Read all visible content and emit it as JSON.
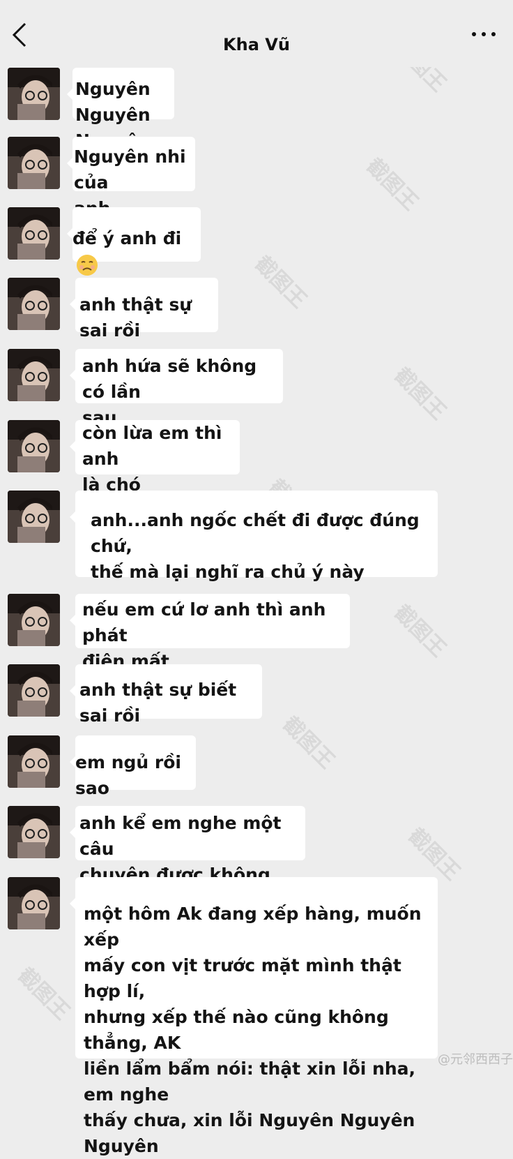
{
  "header": {
    "title": "Kha Vũ",
    "back_icon": "chevron-left-icon",
    "more_icon": "more-dots-icon"
  },
  "messages": [
    {
      "text": "Nguyên Nguyên\nNguyên"
    },
    {
      "text": "Nguyên nhi của\nanh"
    },
    {
      "text": "để ý anh đi",
      "emoji": "pouting-face-emoji"
    },
    {
      "text": "anh thật sự sai rồi"
    },
    {
      "text": "anh hứa sẽ không có lần\nsau"
    },
    {
      "text": "còn lừa em thì anh\nlà chó"
    },
    {
      "text": "anh...anh ngốc chết đi được đúng chứ,\nthế mà lại nghĩ ra chủ ý này"
    },
    {
      "text": "nếu em cứ lơ anh thì anh phát\nđiên mất"
    },
    {
      "text": "anh thật sự biết sai rồi"
    },
    {
      "text": "em ngủ rồi sao"
    },
    {
      "text": "anh kể em nghe một câu\nchuyện được không"
    },
    {
      "text": "một hôm Ak đang xếp hàng, muốn xếp\nmấy con vịt trước mặt mình thật hợp lí,\nnhưng xếp thế nào cũng không thẳng, AK\nliền lẩm bẩm nói: thật xin lỗi nha, em nghe\nthấy chưa, xin lỗi Nguyên Nguyên Nguyên"
    }
  ],
  "watermark": {
    "text": "截图王"
  },
  "footer_watermark": "@元邻西西子",
  "colors": {
    "background": "#ededed",
    "bubble": "#ffffff",
    "text": "#141414"
  }
}
